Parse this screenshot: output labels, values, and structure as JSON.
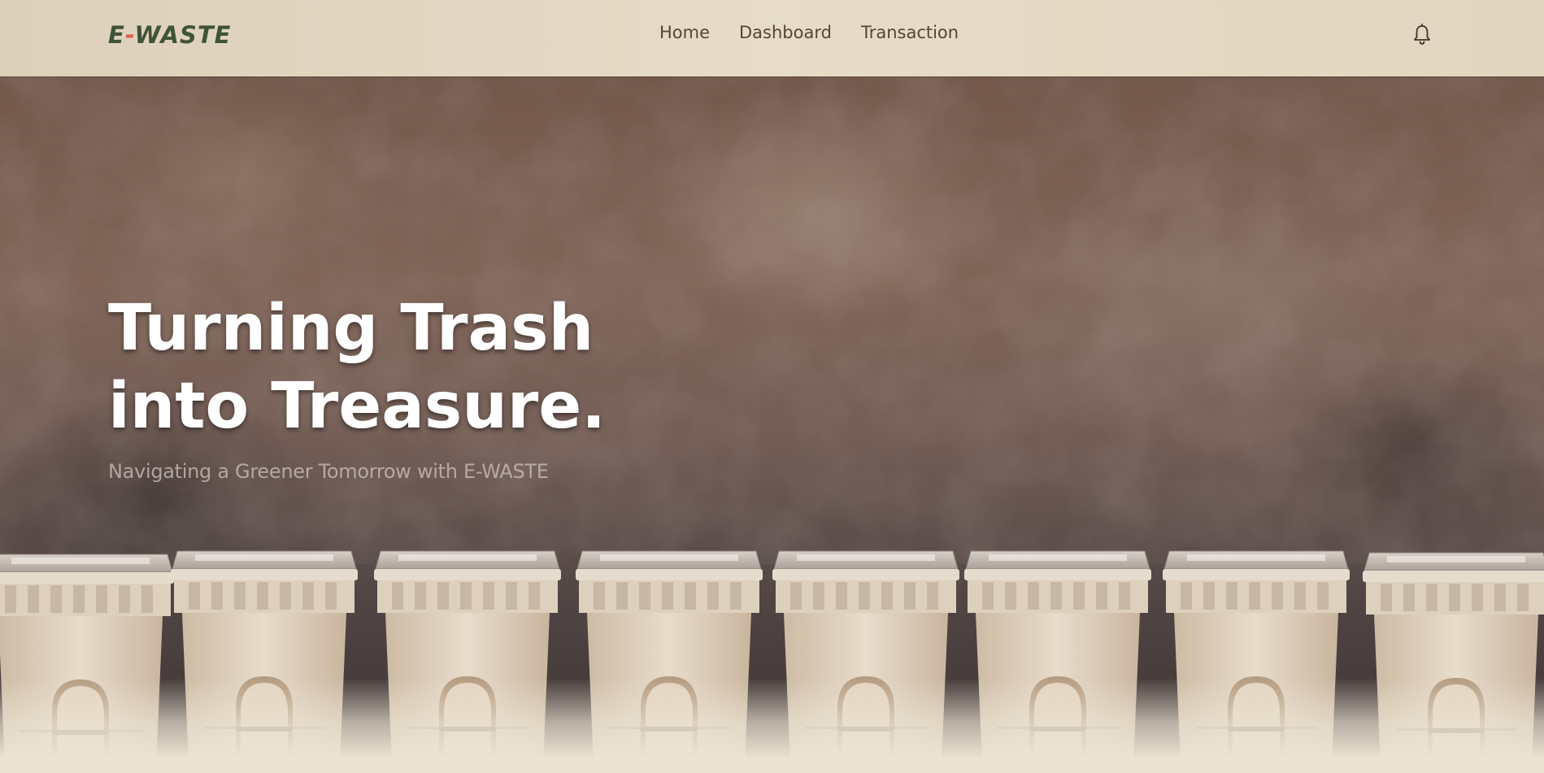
{
  "brand": {
    "logo_prefix": "E",
    "logo_dash": "-",
    "logo_suffix": "WASTE",
    "primary_color": "#3f5338",
    "accent_color": "#d6644d"
  },
  "nav": {
    "items": [
      {
        "label": "Home"
      },
      {
        "label": "Dashboard"
      },
      {
        "label": "Transaction"
      }
    ],
    "notification_icon": "bell-icon"
  },
  "hero": {
    "title_line1": "Turning Trash",
    "title_line2": "into Treasure.",
    "subtitle": "Navigating a Greener Tomorrow with E-WASTE",
    "background_image": "row-of-trash-bins-against-brown-wall"
  }
}
